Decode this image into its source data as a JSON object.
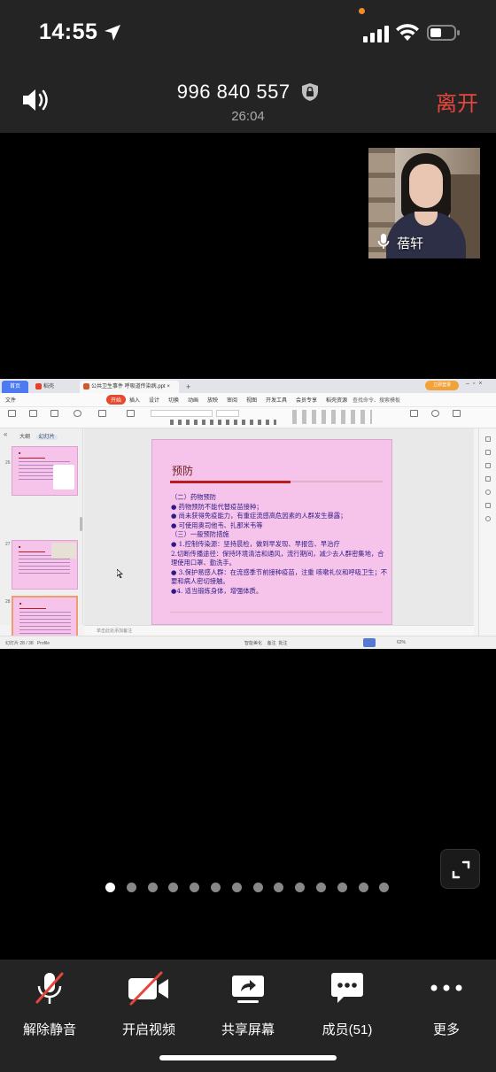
{
  "status_bar": {
    "time": "14:55"
  },
  "header": {
    "meeting_id": "996 840 557",
    "duration": "26:04",
    "leave_label": "离开"
  },
  "participant": {
    "name": "蓓轩"
  },
  "shared_screen": {
    "app_tabs": {
      "home": "首页",
      "wps": "稻壳",
      "document": "公共卫生事件 呼吸道传染病.ppt",
      "login": "立即登录"
    },
    "menu": [
      "文件",
      "开始",
      "插入",
      "设计",
      "切换",
      "动画",
      "放映",
      "审阅",
      "视图",
      "开发工具",
      "会员专享",
      "稻壳资源"
    ],
    "menu_active": "开始",
    "search": "查找命令、搜索模板",
    "side_tabs": {
      "outline": "大纲",
      "slides": "幻灯片"
    },
    "slide_numbers": [
      "26",
      "27",
      "28"
    ],
    "slide": {
      "title": "预防",
      "lines": [
        "（二）药物预防",
        "● 药物预防不能代替疫苗接种；",
        "● 尚未获得免疫能力，有重症流感高危因素的人群发生暴露；",
        "● 可使用奥司他韦、扎那米韦等",
        "（三）一般预防措施",
        "● 1.控制传染源：坚持晨检，做到早发现、早报告、早治疗",
        "2.切断传播途径：保持环境清洁和通风，流行期间，减少去人群密集地，合理使用口罩、勤洗手。",
        "● 3.保护易感人群：在流感季节前接种疫苗，注重 咳嗽礼仪和呼吸卫生；不要和病人密切接触。",
        "●4. 适当锻炼身体，增强体质。"
      ]
    },
    "notes_placeholder": "单击此处添加备注",
    "status": {
      "slide_info": "幻灯片 28 / 38",
      "theme": "Profile",
      "smart": "智能美化",
      "notes": "备注",
      "comment": "批注",
      "zoom": "62%"
    }
  },
  "pager": {
    "count": 14,
    "active_index": 0
  },
  "toolbar": {
    "mute": "解除静音",
    "video": "开启视频",
    "share": "共享屏幕",
    "members": "成员(51)",
    "more": "更多"
  },
  "colors": {
    "leave": "#e4463d",
    "bar_bg": "#242424",
    "slide_bg": "#f6c3ea"
  }
}
